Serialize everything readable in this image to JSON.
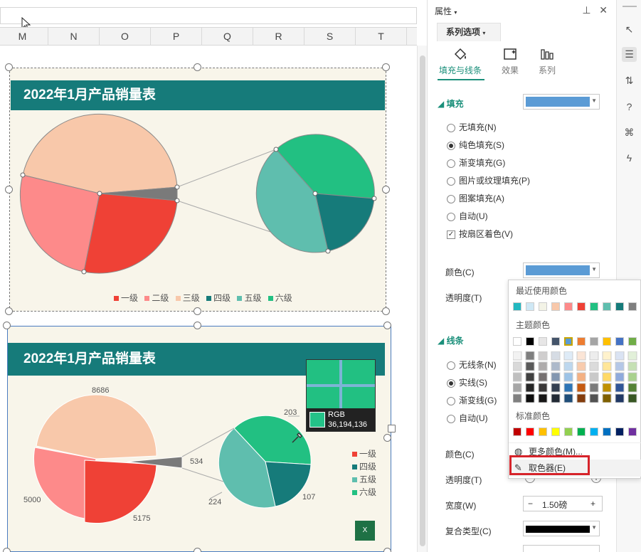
{
  "sheet": {
    "columns": [
      "M",
      "N",
      "O",
      "P",
      "Q",
      "R",
      "S",
      "T"
    ]
  },
  "chart_top": {
    "title": "2022年1月产品销量表",
    "legend": [
      {
        "label": "一级",
        "color": "#ef4136"
      },
      {
        "label": "二级",
        "color": "#fd8a8a"
      },
      {
        "label": "三级",
        "color": "#f8c8aa"
      },
      {
        "label": "四级",
        "color": "#167b7a"
      },
      {
        "label": "五级",
        "color": "#5fbeae"
      },
      {
        "label": "六级",
        "color": "#22c082"
      }
    ]
  },
  "chart_data": {
    "type": "pie",
    "title": "2022年1月产品销量表",
    "categories": [
      "一级",
      "二级",
      "三级",
      "四级",
      "五级",
      "六级"
    ],
    "values": [
      5175,
      5000,
      8686,
      107,
      224,
      203
    ],
    "data_labels": [
      "5175",
      "5000",
      "8686",
      "107",
      "224",
      "203",
      "534"
    ],
    "secondary_pie_total": 534,
    "legend_position": "right"
  },
  "chart_bottom": {
    "title": "2022年1月产品销量表",
    "labels": {
      "v8686": "8686",
      "v5000": "5000",
      "v5175": "5175",
      "v534": "534",
      "v203": "203",
      "v224": "224",
      "v107": "107"
    },
    "legend_visible": [
      "一级",
      "四级",
      "五级",
      "六级"
    ],
    "picker": {
      "rgb_label": "RGB",
      "rgb_value": "36,194,136"
    }
  },
  "panel": {
    "title": "属性",
    "tab": "系列选项",
    "subtabs": [
      "填充与线条",
      "效果",
      "系列"
    ],
    "fill_section": "填充",
    "fill_color": "#5b9bd5",
    "fill_options": [
      "无填充(N)",
      "纯色填充(S)",
      "渐变填充(G)",
      "图片或纹理填充(P)",
      "图案填充(A)",
      "自动(U)"
    ],
    "vary_color": "按扇区着色(V)",
    "color_label": "颜色(C)",
    "transparency_label": "透明度(T)",
    "line_section": "线条",
    "line_options": [
      "无线条(N)",
      "实线(S)",
      "渐变线(G)",
      "自动(U)"
    ],
    "line_color_label": "颜色(C)",
    "line_transparency_label": "透明度(T)",
    "width_label": "宽度(W)",
    "width_value": "1.50磅",
    "compound_label": "复合类型(C)"
  },
  "dropdown": {
    "recent_label": "最近使用颜色",
    "recent_colors": [
      "#22b8c0",
      "#cfe8f5",
      "#f3f3e6",
      "#f8c8aa",
      "#fd8a8a",
      "#ef4136",
      "#22c082",
      "#5fbeae",
      "#167b7a",
      "#7f7f7f"
    ],
    "theme_label": "主题颜色",
    "theme_colors": [
      "#ffffff",
      "#000000",
      "#e7e6e6",
      "#44546a",
      "#5b9bd5",
      "#ed7d31",
      "#a5a5a5",
      "#ffc000",
      "#4472c4",
      "#70ad47"
    ],
    "standard_label": "标准颜色",
    "standard_colors": [
      "#c00000",
      "#ff0000",
      "#ffc000",
      "#ffff00",
      "#92d050",
      "#00b050",
      "#00b0f0",
      "#0070c0",
      "#002060",
      "#7030a0"
    ],
    "more_colors": "更多颜色(M)...",
    "eyedropper": "取色器(E)"
  }
}
